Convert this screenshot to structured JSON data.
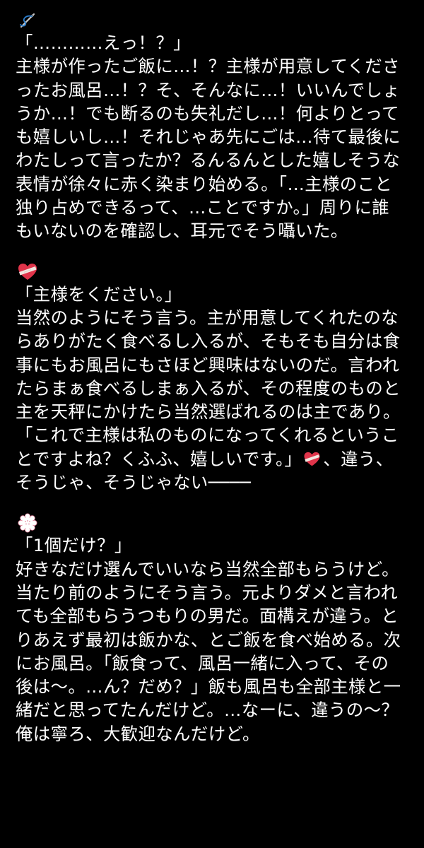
{
  "sections": [
    {
      "icon": "needle-and-thread-icon",
      "lines": [
        "「…………えっ！？」",
        "主様が作ったご飯に…！？主様が用意してくださ",
        "ったお風呂…！？そ、そんなに…！いいんでしょ",
        "うか…！でも断るのも失礼だし…！何よりとって",
        "も嬉しいし…！それじゃあ先にごは…待て最後に",
        "わたしって言ったか？るんるんとした嬉しそうな",
        "表情が徐々に赤く染まり始める。「…主様のこと",
        "独り占めできるって、…ことですか。」周りに誰",
        "もいないのを確認し、耳元でそう囁いた。"
      ]
    },
    {
      "icon": "bandaged-heart-icon",
      "lines": [
        "「主様をください。」",
        "当然のようにそう言う。主が用意してくれたのな",
        "らありがたく食べるし入るが、そもそも自分は食",
        "事にもお風呂にもさほど興味はないのだ。言われ",
        "たらまぁ食べるしまぁ入るが、その程度のものと",
        "主を天秤にかけたら当然選ばれるのは主であり。",
        "「これで主様は私のものになってくれるというこ"
      ],
      "line_with_icon_before": "とですよね？くふふ、嬉しいです。」",
      "line_with_icon_after": "、違う、",
      "last_line": "そうじゃ、そうじゃない────"
    },
    {
      "icon": "white-flower-icon",
      "lines": [
        "「1個だけ？」",
        "好きなだけ選んでいいなら当然全部もらうけど。",
        "当たり前のようにそう言う。元よりダメと言われ",
        "ても全部もらうつもりの男だ。面構えが違う。と",
        "りあえず最初は飯かな、とご飯を食べ始める。次",
        "にお風呂。「飯食って、風呂一緒に入って、その",
        "後は〜。…ん？だめ？」飯も風呂も全部主様と一",
        "緒だと思ってたんだけど。…なーに、違うの〜？",
        "俺は寧ろ、大歓迎なんだけど。"
      ]
    }
  ],
  "colors": {
    "background": "#000000",
    "text": "#ffffff",
    "heart": "#e0344a",
    "bandage": "#f2e6e0",
    "flower": "#ffffff",
    "needle": "#2b7fd0"
  }
}
